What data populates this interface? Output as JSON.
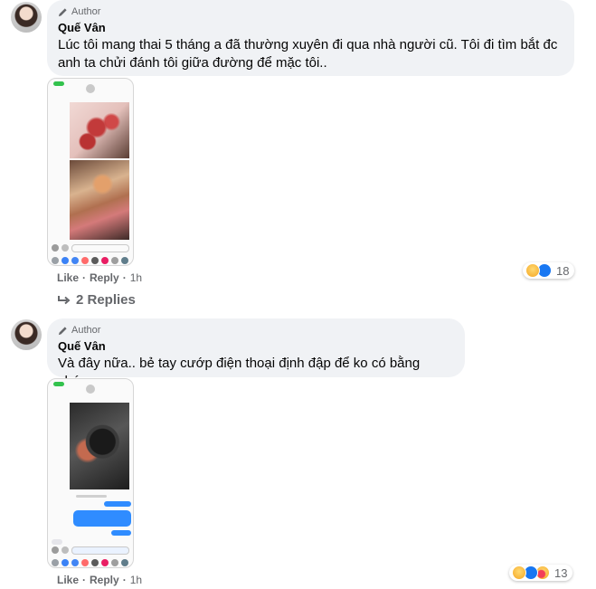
{
  "comments": [
    {
      "badge": "Author",
      "name": "Quế Vân",
      "text": "Lúc tôi mang thai 5 tháng a đã thường xuyên đi qua nhà người cũ. Tôi đi tìm bắt đc anh ta chửi đánh tôi giữa đường để mặc tôi..",
      "like": "Like",
      "reply": "Reply",
      "time": "1h",
      "reaction_count": "18",
      "replies_label": "2 Replies"
    },
    {
      "badge": "Author",
      "name": "Quế Vân",
      "text": "Và đây nữa.. bẻ tay cướp điện thoại định đập để ko có bằng chứng",
      "like": "Like",
      "reply": "Reply",
      "time": "1h",
      "reaction_count": "13"
    }
  ],
  "icons": {
    "author_badge": "pencil-icon",
    "replies_arrow": "reply-arrow-icon",
    "reactions": [
      "sad-icon",
      "like-icon",
      "care-icon"
    ]
  },
  "colors": {
    "bubble": "#f0f2f5",
    "muted_text": "#65676b",
    "like_blue": "#1877f2",
    "reaction_yellow": "#f7b125"
  }
}
